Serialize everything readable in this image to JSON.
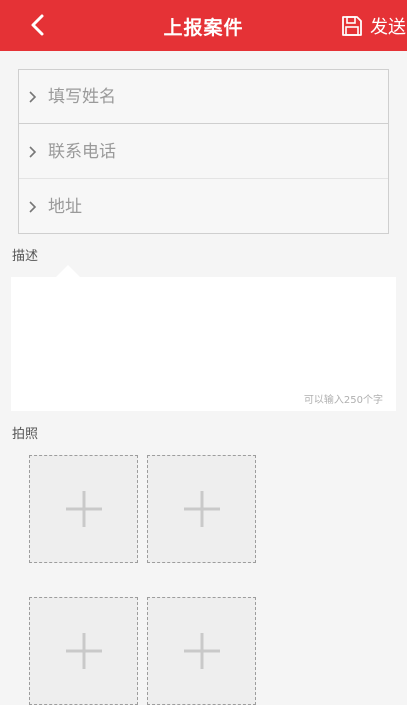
{
  "header": {
    "title": "上报案件",
    "send_label": "发送",
    "accent_color": "#e53236"
  },
  "form": {
    "name_placeholder": "填写姓名",
    "phone_placeholder": "联系电话",
    "address_placeholder": "地址"
  },
  "description": {
    "label": "描述",
    "counter": "可以输入250个字"
  },
  "photos": {
    "label": "拍照",
    "slots": [
      "add-photo",
      "add-photo",
      "add-photo",
      "add-photo"
    ]
  },
  "icons": {
    "back": "chevron-left-icon",
    "send": "floppy-disk-icon",
    "row": "chevron-right-icon",
    "add": "plus-icon"
  }
}
